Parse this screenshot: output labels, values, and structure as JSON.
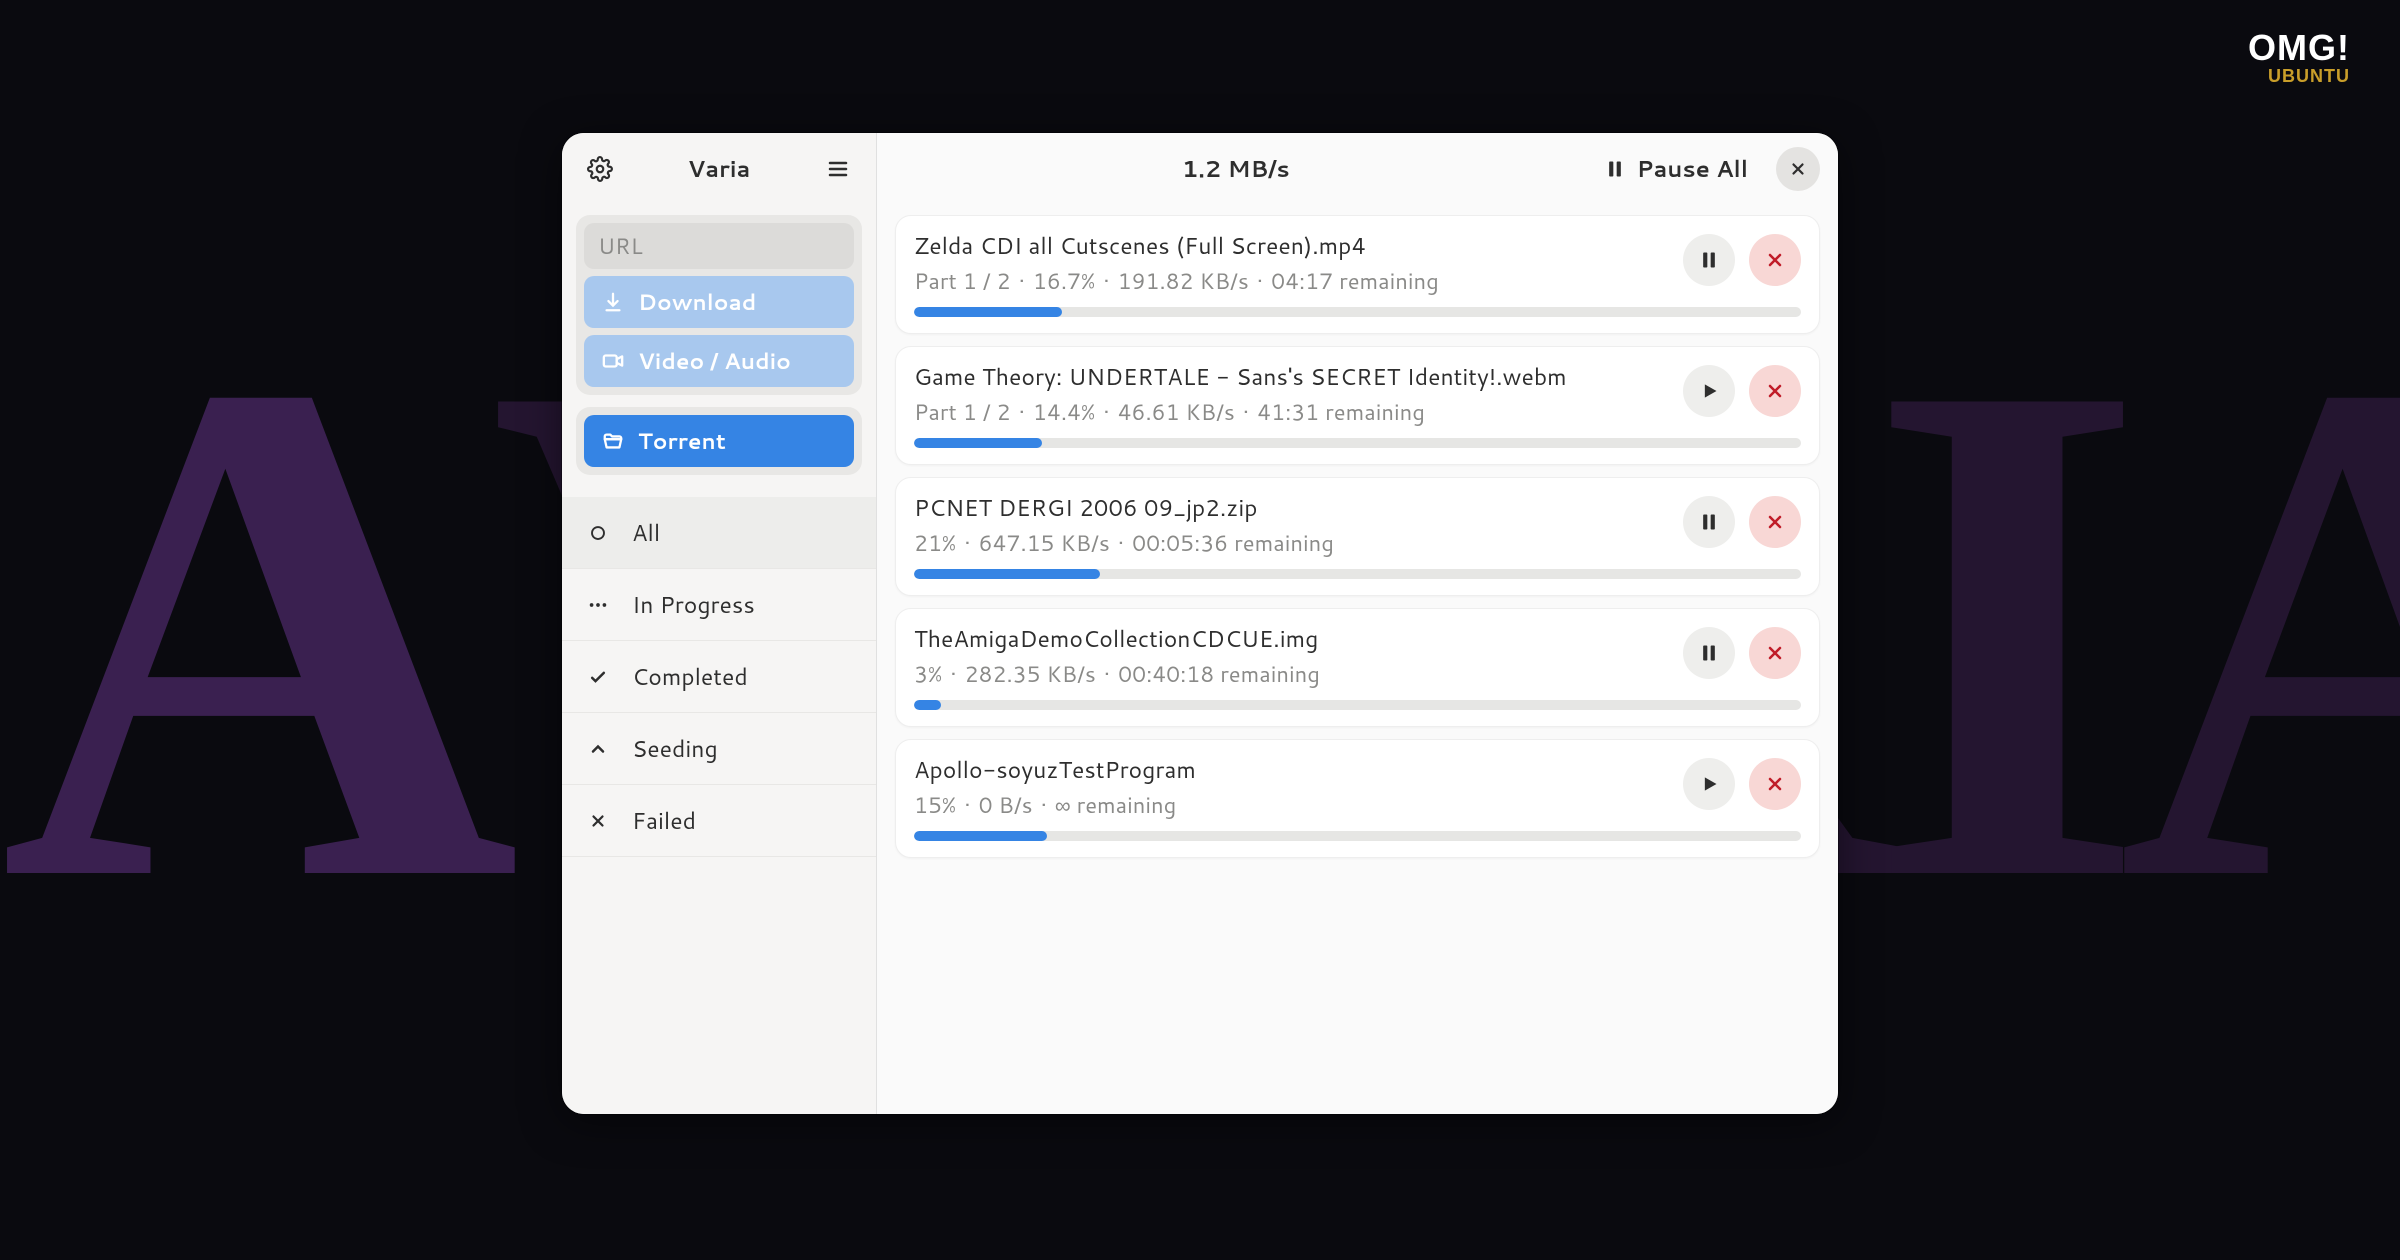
{
  "watermark": {
    "line1": "OMG!",
    "line2": "UBUNTU"
  },
  "app": {
    "title": "Varia"
  },
  "sidebar": {
    "url_placeholder": "URL",
    "download_label": "Download",
    "video_audio_label": "Video / Audio",
    "torrent_label": "Torrent",
    "filters": {
      "all": "All",
      "in_progress": "In Progress",
      "completed": "Completed",
      "seeding": "Seeding",
      "failed": "Failed"
    }
  },
  "header": {
    "speed": "1.2 MB/s",
    "pause_all_label": "Pause All"
  },
  "downloads": [
    {
      "title": "Zelda CDI all Cutscenes (Full Screen).mp4",
      "part": "Part 1 / 2",
      "percent": "16.7%",
      "speed": "191.82 KB/s",
      "remaining": "04:17 remaining",
      "progress": 16.7,
      "action": "pause"
    },
    {
      "title": "Game Theory: UNDERTALE - Sans's SECRET Identity!.webm",
      "part": "Part 1 / 2",
      "percent": "14.4%",
      "speed": "46.61 KB/s",
      "remaining": "41:31 remaining",
      "progress": 14.4,
      "action": "play"
    },
    {
      "title": "PCNET DERGI 2006 09_jp2.zip",
      "part": "",
      "percent": "21%",
      "speed": "647.15  KB/s",
      "remaining": "00:05:36 remaining",
      "progress": 21,
      "action": "pause"
    },
    {
      "title": "TheAmigaDemoCollectionCDCUE.img",
      "part": "",
      "percent": "3%",
      "speed": "282.35  KB/s",
      "remaining": "00:40:18 remaining",
      "progress": 3,
      "action": "pause"
    },
    {
      "title": "Apollo-soyuzTestProgram",
      "part": "",
      "percent": "15%",
      "speed": "0  B/s",
      "remaining": "∞ remaining",
      "progress": 15,
      "action": "play"
    }
  ]
}
